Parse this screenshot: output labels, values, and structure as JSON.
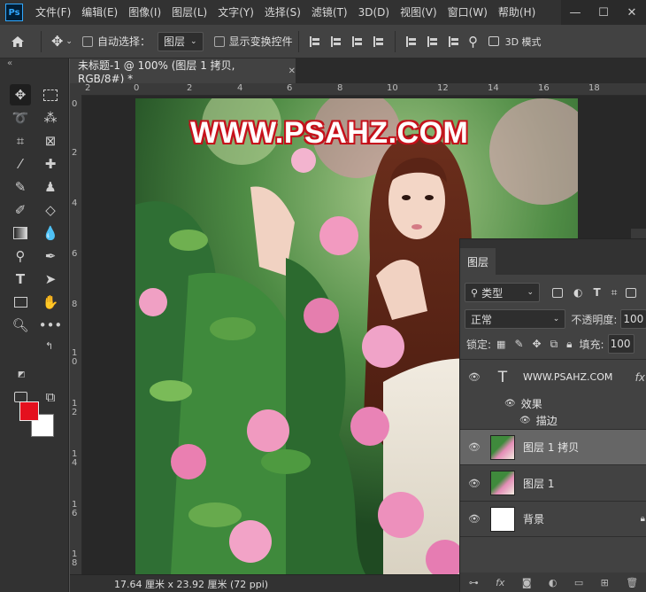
{
  "app": {
    "logo": "Ps"
  },
  "menu": [
    "文件(F)",
    "编辑(E)",
    "图像(I)",
    "图层(L)",
    "文字(Y)",
    "选择(S)",
    "滤镜(T)",
    "3D(D)",
    "视图(V)",
    "窗口(W)",
    "帮助(H)"
  ],
  "window_controls": {
    "minimize": "—",
    "maximize": "☐",
    "close": "✕"
  },
  "options": {
    "auto_select_label": "自动选择：",
    "auto_select_value": "图层",
    "show_transform_label": "显示变换控件",
    "mode_3d": "3D 模式"
  },
  "document": {
    "tab_title": "未标题-1 @ 100% (图层 1 拷贝, RGB/8#) *",
    "status": "17.64 厘米 x 23.92 厘米 (72 ppi)",
    "watermark": "WWW.PSAHZ.COM"
  },
  "ruler": {
    "top": [
      "2",
      "0",
      "2",
      "4",
      "6",
      "8",
      "10",
      "12",
      "14",
      "16",
      "18"
    ],
    "left": [
      "0",
      "2",
      "4",
      "6",
      "8",
      "1\n0",
      "1\n2",
      "1\n4",
      "1\n6",
      "1\n8"
    ]
  },
  "layers_panel": {
    "tab": "图层",
    "filter_kind": "类型",
    "blend_mode": "正常",
    "opacity_label": "不透明度:",
    "opacity_value": "100",
    "lock_label": "锁定:",
    "fill_label": "填充:",
    "fill_value": "100",
    "layers": [
      {
        "name": "WWW.PSAHZ.COM",
        "type": "text",
        "fx": "fx"
      },
      {
        "name": "图层 1 拷贝",
        "type": "image",
        "selected": true
      },
      {
        "name": "图层 1",
        "type": "image"
      },
      {
        "name": "背景",
        "type": "background"
      }
    ],
    "effects_label": "效果",
    "stroke_label": "描边",
    "bottom_fx": "fx"
  },
  "colors": {
    "foreground": "#e4101e",
    "background": "#ffffff",
    "accent": "#31a8ff"
  }
}
